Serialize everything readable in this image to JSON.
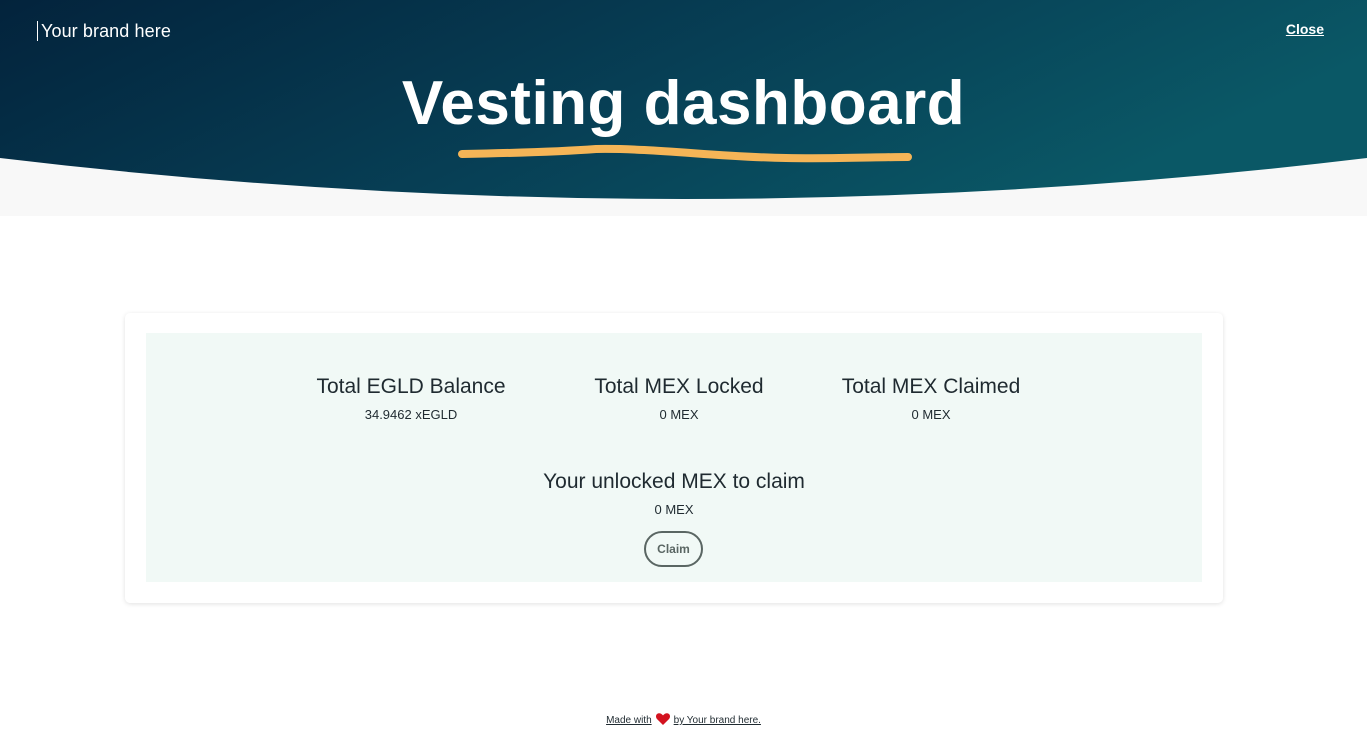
{
  "header": {
    "brand": "Your brand here",
    "close_label": "Close",
    "title": "Vesting dashboard"
  },
  "stats": [
    {
      "title": "Total EGLD Balance",
      "value": "34.9462 xEGLD"
    },
    {
      "title": "Total MEX Locked",
      "value": "0 MEX"
    },
    {
      "title": "Total MEX Claimed",
      "value": "0 MEX"
    }
  ],
  "unlocked": {
    "title": "Your unlocked MEX to claim",
    "value": "0 MEX",
    "claim_label": "Claim"
  },
  "footer": {
    "made_with": "Made with",
    "by_brand": "by Your brand here."
  },
  "colors": {
    "header_dark": "#03243d",
    "header_teal": "#0a5866",
    "accent_underline": "#f5b557",
    "panel_bg": "#f1f9f6",
    "heart": "#d3121f"
  },
  "icons": {
    "heart": "heart-icon"
  }
}
